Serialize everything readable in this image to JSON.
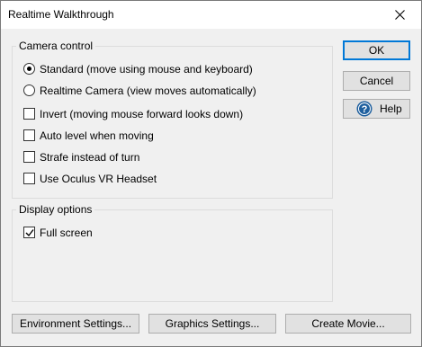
{
  "window": {
    "title": "Realtime Walkthrough"
  },
  "camera_control": {
    "label": "Camera control",
    "radio_standard": {
      "label": "Standard (move using mouse and keyboard)",
      "selected": true
    },
    "radio_realtime": {
      "label": "Realtime Camera (view moves automatically)",
      "selected": false
    },
    "check_invert": {
      "label": "Invert (moving mouse forward looks down)",
      "checked": false
    },
    "check_auto_level": {
      "label": "Auto level when moving",
      "checked": false
    },
    "check_strafe": {
      "label": "Strafe instead of turn",
      "checked": false
    },
    "check_oculus": {
      "label": "Use Oculus VR Headset",
      "checked": false
    }
  },
  "display_options": {
    "label": "Display options",
    "check_full_screen": {
      "label": "Full screen",
      "checked": true
    }
  },
  "buttons": {
    "ok": "OK",
    "cancel": "Cancel",
    "help": "Help",
    "environment_settings": "Environment Settings...",
    "graphics_settings": "Graphics Settings...",
    "create_movie": "Create Movie..."
  },
  "colors": {
    "accent": "#0078d7",
    "help_icon": "#1e5f9e"
  }
}
